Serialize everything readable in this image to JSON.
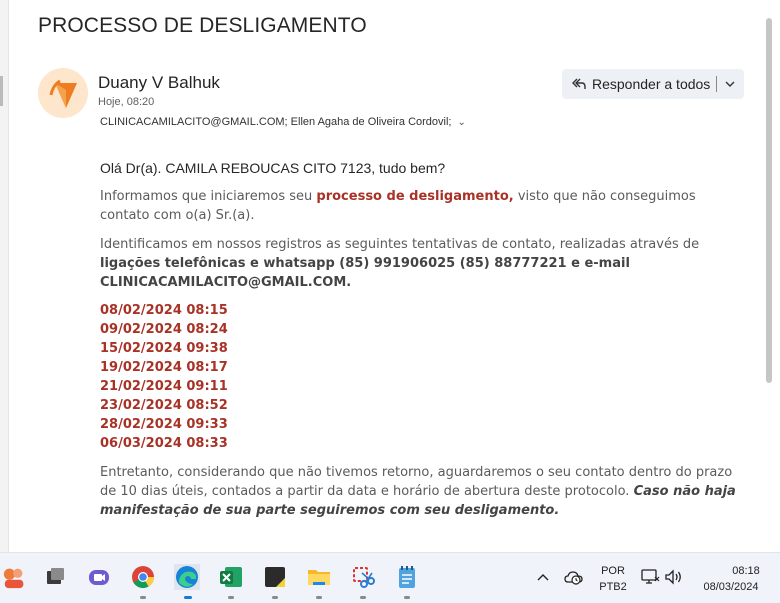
{
  "email": {
    "subject": "PROCESSO DE DESLIGAMENTO",
    "sender": "Duany V Balhuk",
    "date": "Hoje, 08:20",
    "recipients": "CLINICACAMILACITO@GMAIL.COM; Ellen Agaha de Oliveira Cordovil;",
    "reply_all_label": "Responder a todos"
  },
  "body": {
    "greeting": "Olá Dr(a). CAMILA REBOUCAS CITO 7123, tudo bem?",
    "p1_a": "Informamos que iniciaremos seu ",
    "p1_b": "processo de desligamento,",
    "p1_c": " visto que não conseguimos contato com o(a) Sr.(a).",
    "p2_a": "Identificamos em nossos registros as seguintes tentativas de contato, realizadas através de ",
    "p2_b": "ligações telefônicas e whatsapp (85) 991906025 (85) 88777221 e e-mail CLINICACAMILACITO@GMAIL.COM.",
    "attempts": [
      "08/02/2024 08:15",
      "09/02/2024 08:24",
      "15/02/2024 09:38",
      "19/02/2024 08:17",
      "21/02/2024 09:11",
      "23/02/2024 08:52",
      "28/02/2024 09:33",
      "06/03/2024 08:33"
    ],
    "p3_a": "Entretanto, considerando que não tivemos retorno, aguardaremos o seu contato dentro do prazo de 10 dias úteis, contados a partir da data e horário de abertura deste protocolo. ",
    "p3_b": "Caso não haja manifestação de sua parte seguiremos com seu desligamento."
  },
  "taskbar": {
    "language": "POR",
    "keyboard": "PTB2",
    "time": "08:18",
    "date": "08/03/2024"
  },
  "colors": {
    "accent_red": "#a93226",
    "reply_bg": "#edf1f5",
    "taskbar_bg": "#f0f3f9"
  }
}
